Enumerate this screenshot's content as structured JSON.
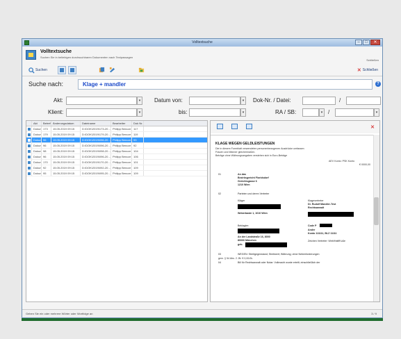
{
  "window": {
    "title": "Volltextsuche",
    "buttons": [
      "–",
      "□",
      "✕"
    ]
  },
  "header": {
    "title": "Volltextsuche",
    "subtitle": "Suchen Sie in beliebigen durchsuchbaren Dokumenten nach Textpassagen",
    "close_label": "Schließen"
  },
  "toolbar": {
    "search_label": "Suchen",
    "close_label": "Schließen",
    "colors": {
      "accent": "#3d7fc3",
      "close": "#d63c3c",
      "brand": "#1f6c2e"
    }
  },
  "search": {
    "label": "Suche nach:",
    "value": "Klage + mandler",
    "help_icon": "?"
  },
  "filters": {
    "akt_label": "Akt:",
    "klient_label": "Klient:",
    "datum_von_label": "Datum von:",
    "bis_label": "bis:",
    "dok_label": "Dok-Nr. / Datei:",
    "ra_label": "RA / SB:",
    "slash": "/"
  },
  "grid": {
    "columns": [
      "",
      "Akt",
      "Betreff",
      "Änderungsdatum",
      "Dateiname",
      "Bearbeiter",
      "Dok Nr."
    ],
    "rows": [
      [
        "Dokument",
        "173",
        "15.05.2019 09:15",
        "D:\\DOK\\2019\\173-20…",
        "Philipp Bencze",
        "117"
      ],
      [
        "Dokument",
        "179",
        "15.05.2019 09:15",
        "D:\\DOK\\2019\\179-20…",
        "Philipp Bencze",
        "119"
      ],
      [
        "Dokument",
        "96",
        "15.05.2019 09:15",
        "D:\\DOK\\2019\\096-20…",
        "Philipp Bencze",
        "93"
      ],
      [
        "Dokument",
        "96",
        "15.05.2019 09:15",
        "D:\\DOK\\2019\\096-20…",
        "Philipp Bencze",
        "92"
      ],
      [
        "Dokument",
        "98",
        "15.05.2019 09:15",
        "D:\\DOK\\2019\\098-20…",
        "Philipp Bencze",
        "104"
      ],
      [
        "Dokument",
        "96",
        "15.05.2019 09:15",
        "D:\\DOK\\2019\\096-20…",
        "Philipp Bencze",
        "106"
      ],
      [
        "Dokument",
        "170",
        "15.05.2019 09:15",
        "D:\\DOK\\2019\\170-20…",
        "Philipp Bencze",
        "101"
      ],
      [
        "Dokument",
        "92",
        "15.05.2019 09:15",
        "D:\\DOK\\2019\\092-20…",
        "Philipp Bencze",
        "109"
      ],
      [
        "Dokument",
        "95",
        "15.05.2019 09:15",
        "D:\\DOK\\2019\\095-20…",
        "Philipp Bencze",
        "109"
      ]
    ],
    "selected_row": 2
  },
  "preview": {
    "title": "KLAGE WEGEN GELDLEISTUNGEN",
    "intro": [
      "Die in diesem Formblatt verwendeten personenbezogenen Ausdrücke umfassen",
      "Frauen und Männer gleichermaßen.",
      "Beträge ohne Währungsangaben verstehen sich in Euro-Beträge"
    ],
    "fee_line": "AEV Konto: PSK Konto",
    "fee_sub": "€ 0000,00",
    "sections": [
      {
        "num": "01",
        "lines": [
          "An das",
          "Bezirksgericht Floridsdorf",
          "Gerichtsgasse 6",
          "1210 Wien"
        ]
      },
      {
        "num": "02",
        "lines": [
          "Parteien und deren Vertreter"
        ]
      }
    ],
    "party_left": {
      "label": "Kläger",
      "address": "Weberbaste 1, 1010 Wien",
      "defendant_label": "Beklagter:",
      "defendant_address": "An der Landstraße 16, 8000",
      "defendant_city": "80000 München",
      "born": "geb."
    },
    "party_right": {
      "label": "Klagevertreter",
      "name": "Dr. Rudolf Mandler-Test",
      "role": "Rechtsanwalt",
      "code": "Code P",
      "bank": "Ander",
      "account": "Konto 111111, BLZ 11111",
      "reference": "Zeichen Vertreter: Web/Haff/Kuße"
    },
    "section03": {
      "num": "03",
      "text": "WEGEN: Streitgegenstand; Streitwert; Währung; ohne Nebenforderungen"
    },
    "section03b": "gem. § 54 Abs. 2 JN: € 0,00/Jk.",
    "section04": {
      "num": "04",
      "text": "Bill für Rechtsanwalt oder Notar: Vollmacht wurde erteilt; einschließlich der"
    }
  },
  "statusbar": {
    "left": "Geben Sie ein oder mehrere Wörter oder Wortfolge an",
    "right": "3 / 9"
  }
}
